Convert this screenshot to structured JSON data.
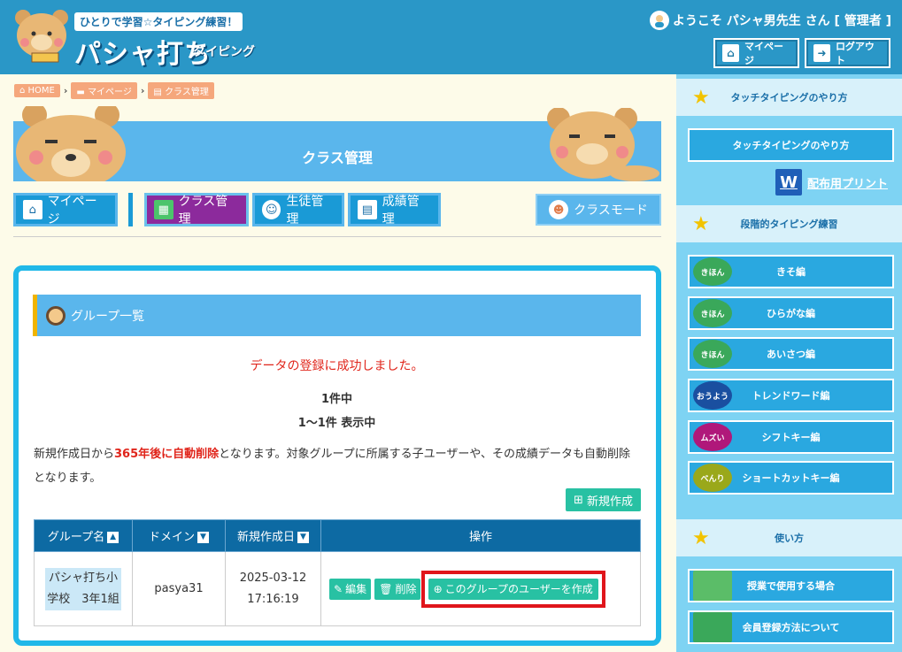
{
  "header": {
    "tagline": "ひとりで学習☆タイピング練習！",
    "logo_title": "パシャ打ち",
    "logo_sub": "タイピング",
    "welcome": "ようこそ パシャ男先生 さん [ 管理者 ]",
    "mypage": "マイページ",
    "logout": "ログアウト"
  },
  "breadcrumb": [
    "HOME",
    "マイページ",
    "クラス管理"
  ],
  "banner": {
    "title": "クラス管理"
  },
  "nav": {
    "mypage": "マイページ",
    "class": "クラス管理",
    "student": "生徒管理",
    "grades": "成績管理",
    "class_mode": "クラスモード"
  },
  "main": {
    "section_title": "グループ一覧",
    "success": "データの登録に成功しました。",
    "count": "1件中",
    "range": "1～1件 表示中",
    "notice_pre": "新規作成日から",
    "notice_red": "365年後に自動削除",
    "notice_post": "となります。対象グループに所属する子ユーザーや、その成績データも自動削除となります。",
    "new_btn": "新規作成"
  },
  "table": {
    "headers": [
      "グループ名",
      "ドメイン",
      "新規作成日",
      "操作"
    ],
    "rows": [
      {
        "name": "パシャ打ち小学校　3年1組",
        "domain": "pasya31",
        "date": "2025-03-12 17:16:19",
        "edit": "編集",
        "delete": "削除",
        "create_user": "このグループのユーザーを作成"
      }
    ]
  },
  "sidebar": {
    "section1": "タッチタイピングのやり方",
    "btn_touch": "タッチタイピングのやり方",
    "print": "配布用プリント",
    "section2": "段階的タイピング練習",
    "steps": [
      {
        "badge": "きほん",
        "label": "きそ編",
        "color": "#3aa85a"
      },
      {
        "badge": "きほん",
        "label": "ひらがな編",
        "color": "#3aa85a"
      },
      {
        "badge": "きほん",
        "label": "あいさつ編",
        "color": "#3aa85a"
      },
      {
        "badge": "おうよう",
        "label": "トレンドワード編",
        "color": "#1a4fa0"
      },
      {
        "badge": "ムズい",
        "label": "シフトキー編",
        "color": "#b0187a"
      },
      {
        "badge": "べんり",
        "label": "ショートカットキー編",
        "color": "#9aa81a"
      }
    ],
    "section3": "使い方",
    "usage": [
      "授業で使用する場合",
      "会員登録方法について"
    ]
  }
}
